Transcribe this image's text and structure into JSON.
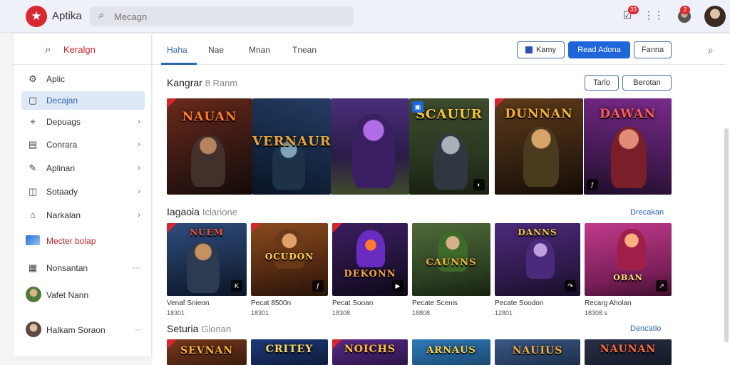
{
  "app": {
    "name": "Aptika"
  },
  "search": {
    "placeholder": "Mecagn"
  },
  "topbar": {
    "notification_count": "33",
    "alert_count": "2"
  },
  "sidebar": {
    "header": "Keralgn",
    "items": [
      {
        "label": "Aplic",
        "icon": "gear-icon"
      },
      {
        "label": "Decajan",
        "icon": "square-icon",
        "active": true
      },
      {
        "label": "Depuags",
        "icon": "tag-icon",
        "chevron": true
      },
      {
        "label": "Conrara",
        "icon": "briefcase-icon",
        "chevron": true
      },
      {
        "label": "Aplinan",
        "icon": "pen-icon",
        "chevron": true
      },
      {
        "label": "Sotaady",
        "icon": "dollar-icon",
        "chevron": true
      },
      {
        "label": "Narkalan",
        "icon": "building-icon",
        "chevron": true
      },
      {
        "label": "Mecter bolap",
        "icon": "photo-icon",
        "red": true
      },
      {
        "label": "Nonsantan",
        "icon": "calendar-icon",
        "more": true
      },
      {
        "label": "Vafet Nann",
        "icon": "avatar"
      },
      {
        "label": "Halkam Soraon",
        "icon": "avatar",
        "more": true
      }
    ]
  },
  "tabs": [
    "Haha",
    "Nae",
    "Mnan",
    "Tnean"
  ],
  "actions": {
    "button1": "Kamy",
    "button2": "Read Adona",
    "button3": "Fanna"
  },
  "featured": {
    "title": "Kangrar",
    "subtitle": "8 Ranm",
    "filter1": "Tarlo",
    "filter2": "Berotan",
    "tiles": [
      {
        "title": "NAUAN"
      },
      {
        "title": "VERNAUR"
      },
      {
        "title": "SCAUUR"
      },
      {
        "title": "DUNNAN"
      },
      {
        "title": "DAWAN"
      }
    ]
  },
  "section2": {
    "title": "Iagaoia",
    "subtitle": "Iclarione",
    "see_all": "Drecakan",
    "items": [
      {
        "art": "NUEM",
        "name": "Venaf Snieon",
        "meta": "18301"
      },
      {
        "art": "OCUDON",
        "name": "Pecat 8500n",
        "meta": "18301"
      },
      {
        "art": "DEKONN",
        "name": "Pecat Sooan",
        "meta": "18308"
      },
      {
        "art": "CAUNNS",
        "name": "Pecate Scenis",
        "meta": "18808"
      },
      {
        "art": "DANNS",
        "name": "Pecate Soodon",
        "meta": "12801"
      },
      {
        "art": "OBAN",
        "name": "Recarg Aholan",
        "meta": "18308 s"
      }
    ]
  },
  "section3": {
    "title": "Seturia",
    "subtitle": "Glonan",
    "see_all": "Dencatio",
    "items": [
      {
        "art": "SEVNAN"
      },
      {
        "art": "CRITEY"
      },
      {
        "art": "NOICHS"
      },
      {
        "art": "ARNAUS"
      },
      {
        "art": "NAUIUS"
      },
      {
        "art": "NAUNAN"
      }
    ]
  },
  "colors": {
    "accent": "#1f66d8",
    "brand": "#d7292f",
    "link": "#2e64b0"
  }
}
